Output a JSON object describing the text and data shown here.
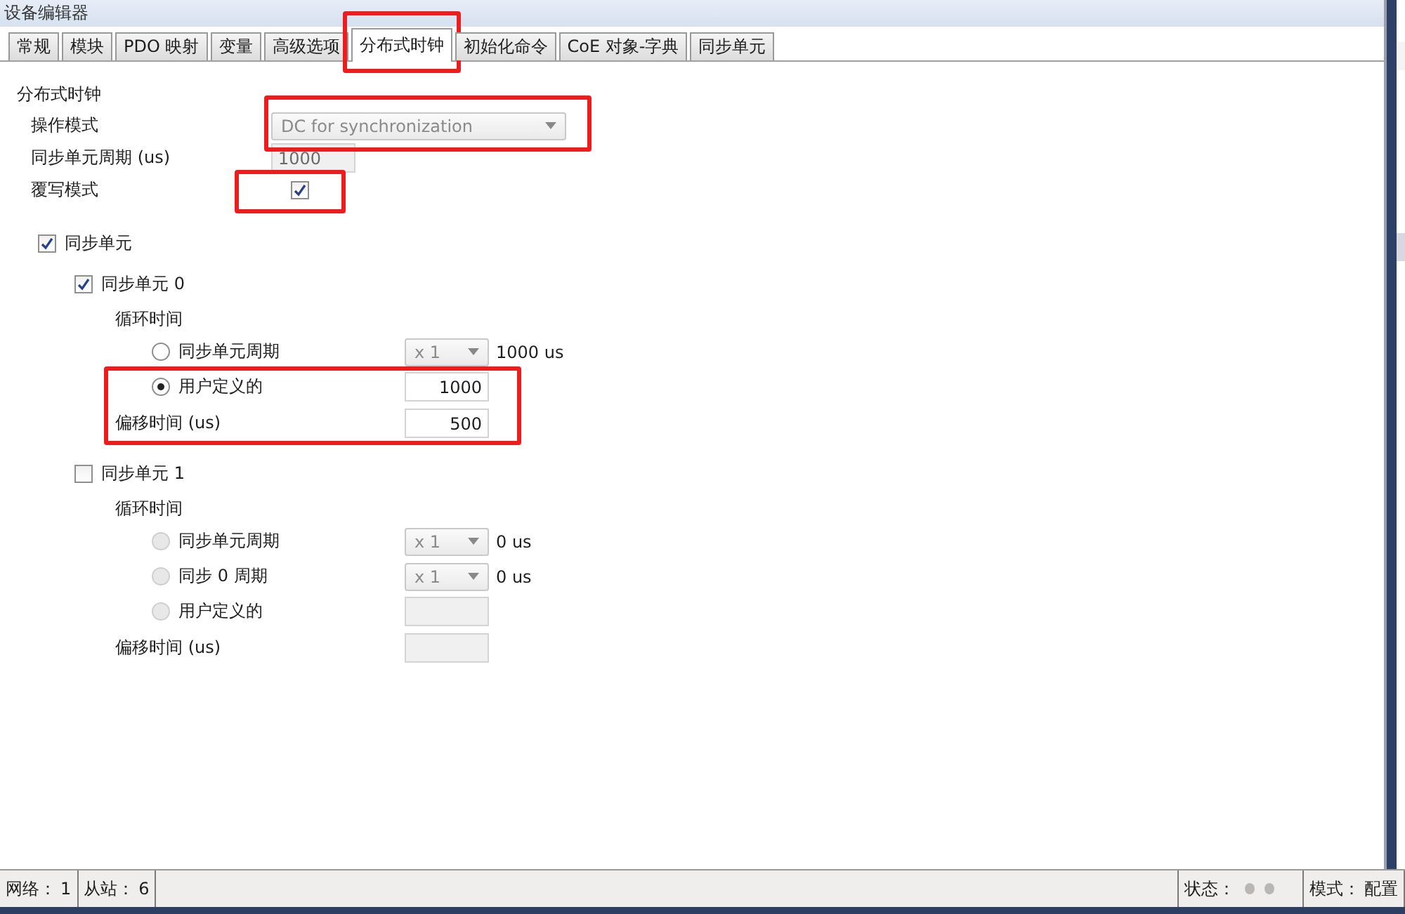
{
  "window": {
    "title": "设备编辑器"
  },
  "tabs": [
    {
      "label": "常规",
      "selected": false,
      "highlighted": false
    },
    {
      "label": "模块",
      "selected": false,
      "highlighted": false
    },
    {
      "label": "PDO 映射",
      "selected": false,
      "highlighted": false
    },
    {
      "label": "变量",
      "selected": false,
      "highlighted": false
    },
    {
      "label": "高级选项",
      "selected": false,
      "highlighted": false
    },
    {
      "label": "分布式时钟",
      "selected": true,
      "highlighted": true
    },
    {
      "label": "初始化命令",
      "selected": false,
      "highlighted": false
    },
    {
      "label": "CoE 对象-字典",
      "selected": false,
      "highlighted": false
    },
    {
      "label": "同步单元",
      "selected": false,
      "highlighted": false
    }
  ],
  "section_title": "分布式时钟",
  "operation_mode": {
    "label": "操作模式",
    "value": "DC for synchronization",
    "disabled": true,
    "highlighted": true
  },
  "sync_unit_cycle": {
    "label": "同步单元周期 (us)",
    "value": "1000",
    "disabled": true
  },
  "overwrite_mode": {
    "label": "覆写模式",
    "checked": true,
    "highlighted": true
  },
  "sync_units_group": {
    "label": "同步单元",
    "checked": true
  },
  "sync_units": [
    {
      "label": "同步单元 0",
      "checked": true,
      "cycle_label": "循环时间",
      "highlighted": true,
      "options": [
        {
          "kind": "multiplier",
          "label": "同步单元周期",
          "selected": false,
          "value": "x 1",
          "reading": "1000 us"
        },
        {
          "kind": "custom",
          "label": "用户定义的",
          "selected": true,
          "value": "1000"
        }
      ],
      "offset": {
        "label": "偏移时间 (us)",
        "value": "500"
      }
    },
    {
      "label": "同步单元 1",
      "checked": false,
      "cycle_label": "循环时间",
      "highlighted": false,
      "options": [
        {
          "kind": "multiplier",
          "label": "同步单元周期",
          "selected": false,
          "value": "x 1",
          "reading": "0 us"
        },
        {
          "kind": "multiplier",
          "label": "同步 0 周期",
          "selected": false,
          "value": "x 1",
          "reading": "0 us"
        },
        {
          "kind": "custom",
          "label": "用户定义的",
          "selected": false
        }
      ],
      "offset": {
        "label": "偏移时间 (us)"
      }
    }
  ],
  "status_bar": [
    {
      "kind": "text",
      "label": "网络：",
      "value": "1"
    },
    {
      "kind": "text",
      "label": "从站：",
      "value": "6"
    },
    {
      "kind": "spacer"
    },
    {
      "kind": "leds",
      "label": "状态："
    },
    {
      "kind": "text",
      "label": "模式：",
      "value": "配置"
    }
  ]
}
